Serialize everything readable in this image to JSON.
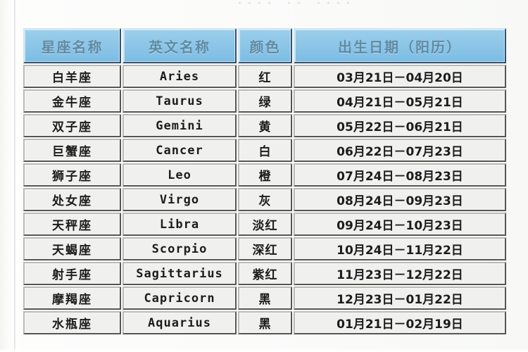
{
  "page": {
    "clipped_top_caption": "・・・・　・・　・・・・",
    "background_color": "#f8f9f7"
  },
  "table": {
    "header_bg_color": "#8ec6e8",
    "header_text_color": "#5f8ba3",
    "cell_bg_color": "#f0f0ee",
    "columns": [
      "星座名称",
      "英文名称",
      "颜色",
      "出生日期（阳历）"
    ],
    "rows": [
      {
        "name": "白羊座",
        "english": "Aries",
        "color": "红",
        "date": "03月21日－04月20日"
      },
      {
        "name": "金牛座",
        "english": "Taurus",
        "color": "绿",
        "date": "04月21日－05月21日"
      },
      {
        "name": "双子座",
        "english": "Gemini",
        "color": "黄",
        "date": "05月22日－06月21日"
      },
      {
        "name": "巨蟹座",
        "english": "Cancer",
        "color": "白",
        "date": "06月22日－07月23日"
      },
      {
        "name": "狮子座",
        "english": "Leo",
        "color": "橙",
        "date": "07月24日－08月23日"
      },
      {
        "name": "处女座",
        "english": "Virgo",
        "color": "灰",
        "date": "08月24日－09月23日"
      },
      {
        "name": "天秤座",
        "english": "Libra",
        "color": "淡红",
        "date": "09月24日－10月23日"
      },
      {
        "name": "天蝎座",
        "english": "Scorpio",
        "color": "深红",
        "date": "10月24日－11月22日"
      },
      {
        "name": "射手座",
        "english": "Sagittarius",
        "color": "紫红",
        "date": "11月23日－12月22日"
      },
      {
        "name": "摩羯座",
        "english": "Capricorn",
        "color": "黑",
        "date": "12月23日－01月22日"
      },
      {
        "name": "水瓶座",
        "english": "Aquarius",
        "color": "黑",
        "date": "01月21日－02月19日"
      }
    ]
  }
}
